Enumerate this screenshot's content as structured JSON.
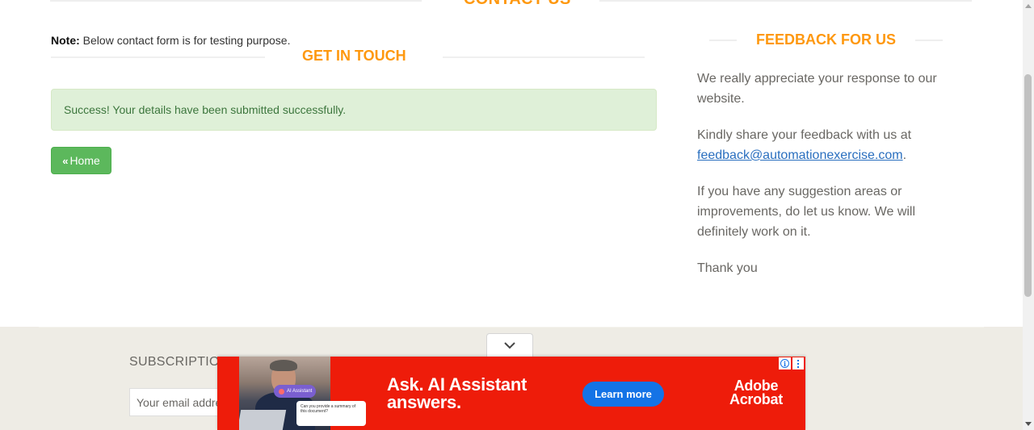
{
  "header": {
    "title": "CONTACT US"
  },
  "note": {
    "label": "Note:",
    "text": " Below contact form is for testing purpose."
  },
  "get_in_touch": {
    "title": "GET IN TOUCH",
    "success_message": "Success! Your details have been submitted successfully.",
    "home_button_label": "Home",
    "home_button_icon": "double-chevron-left-icon"
  },
  "feedback": {
    "title": "FEEDBACK FOR US",
    "paragraph1": "We really appreciate your response to our website.",
    "paragraph2_prefix": "Kindly share your feedback with us at ",
    "email": "feedback@automationexercise.com",
    "paragraph2_suffix": ".",
    "paragraph3": "If you have any suggestion areas or improvements, do let us know. We will definitely work on it.",
    "paragraph4": "Thank you"
  },
  "footer": {
    "subscription_title": "SUBSCRIPTION",
    "email_placeholder": "Your email address"
  },
  "ad": {
    "collapse_icon": "chevron-down-icon",
    "chip_label": "AI Assistant",
    "card_text": "Can you provide a summary of this document?",
    "headline_line1": "Ask. AI Assistant",
    "headline_line2": "answers.",
    "cta_label": "Learn more",
    "brand_line1": "Adobe",
    "brand_line2": "Acrobat",
    "info_icon": "info-icon",
    "menu_icon": "vertical-dots-icon"
  },
  "colors": {
    "accent_orange": "#fe980f",
    "success_bg": "#dff0d8",
    "success_text": "#3c763d",
    "home_button": "#5cb85c",
    "ad_red": "#ee1c0a",
    "ad_button_blue": "#1473e6",
    "link_blue": "#2a6fbf"
  }
}
